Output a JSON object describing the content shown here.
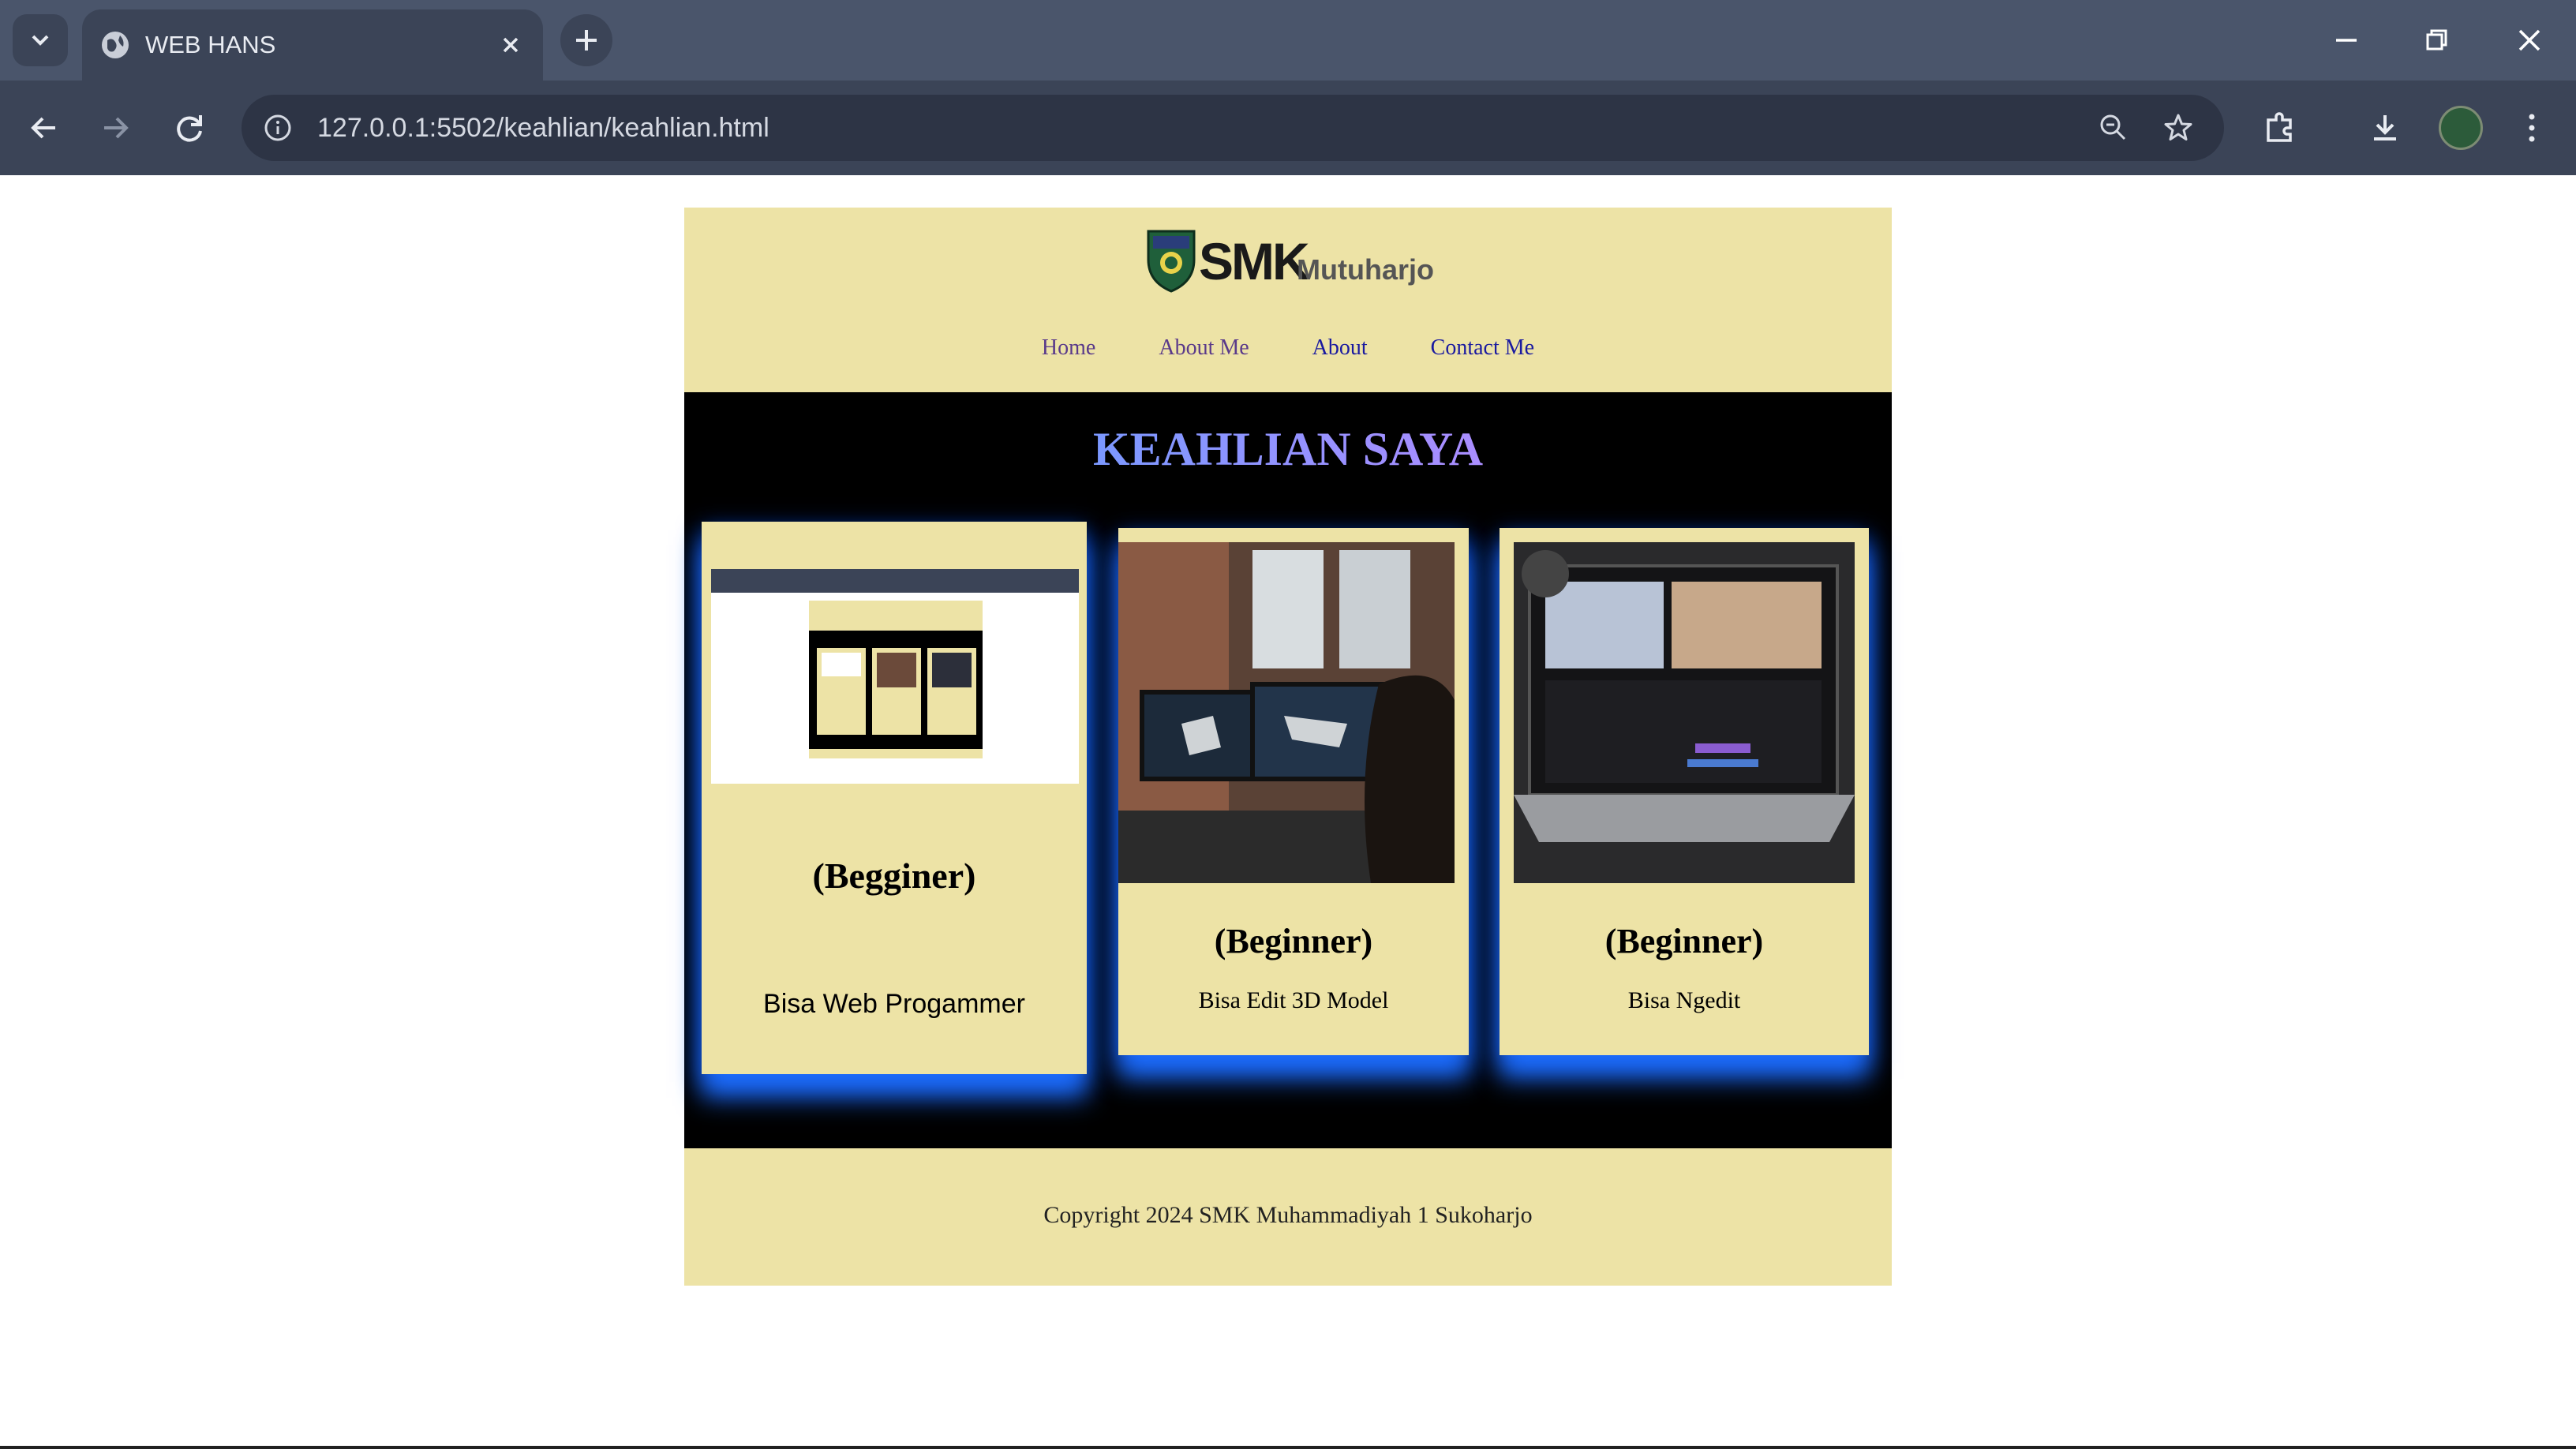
{
  "browser": {
    "tab_title": "WEB HANS",
    "url": "127.0.0.1:5502/keahlian/keahlian.html"
  },
  "header": {
    "logo_main": "SMK",
    "logo_sub": "Mutuharjo",
    "nav": [
      "Home",
      "About Me",
      "About",
      "Contact Me"
    ]
  },
  "main": {
    "title": "KEAHLIAN SAYA",
    "cards": [
      {
        "level": "(Begginer)",
        "description": "Bisa Web Progammer"
      },
      {
        "level": "(Beginner)",
        "description": "Bisa Edit 3D Model"
      },
      {
        "level": "(Beginner)",
        "description": "Bisa Ngedit"
      }
    ]
  },
  "footer": {
    "copyright": "Copyright 2024 SMK Muhammadiyah 1 Sukoharjo"
  },
  "colors": {
    "header_bg": "#ede3a6",
    "content_bg": "#000000",
    "card_glow": "#1e6eff",
    "chrome_bg": "#4a556b"
  }
}
